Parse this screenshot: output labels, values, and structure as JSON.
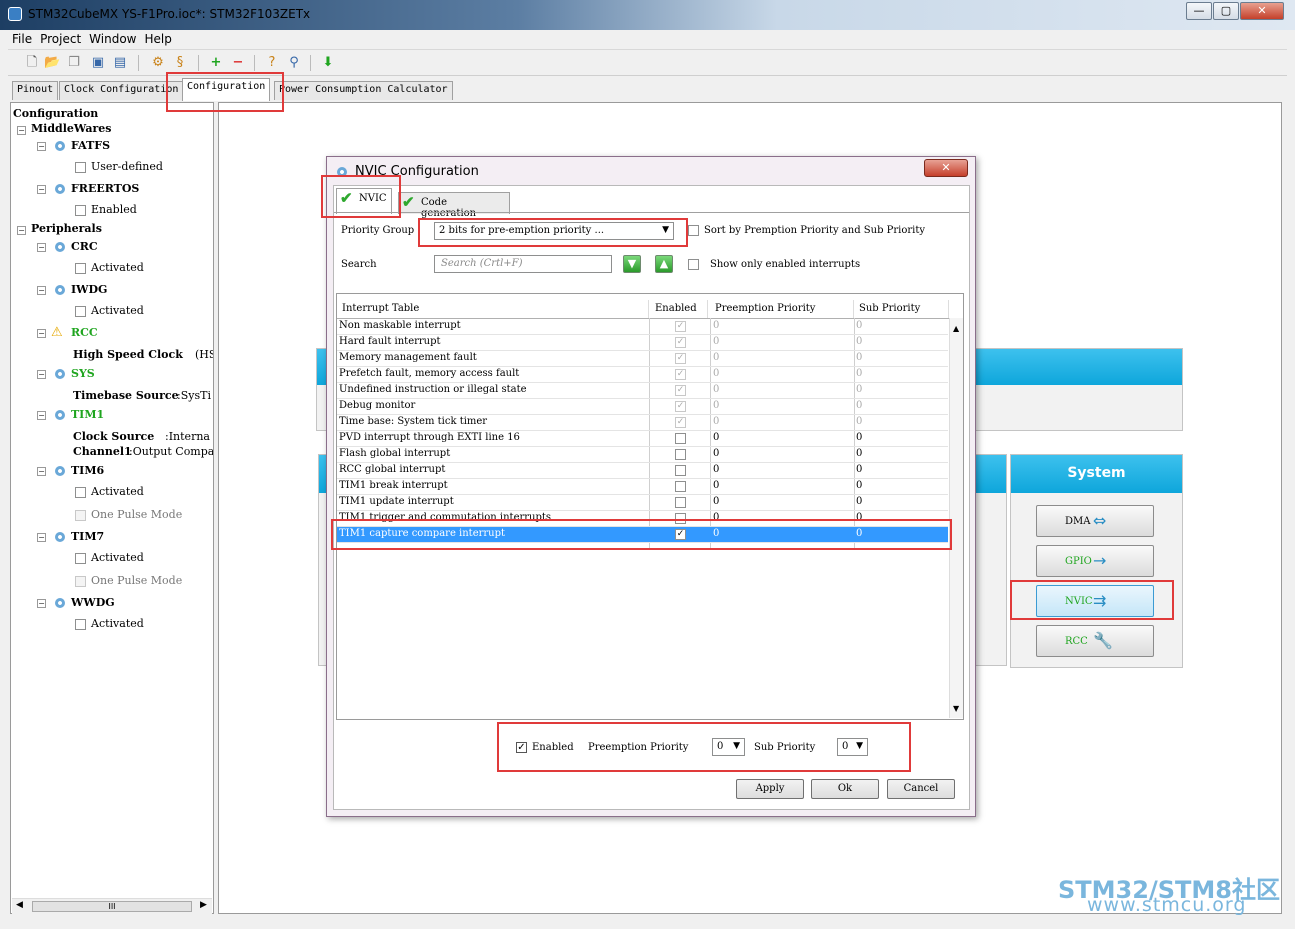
{
  "window": {
    "title": "STM32CubeMX YS-F1Pro.ioc*: STM32F103ZETx",
    "minimize": "—",
    "maximize": "▢",
    "close": "✕"
  },
  "menu": [
    "File",
    "Project",
    "Window",
    "Help"
  ],
  "main_tabs": [
    "Pinout",
    "Clock Configuration",
    "Configuration",
    "Power Consumption Calculator"
  ],
  "tree": {
    "root": "Configuration",
    "middlewares": "MiddleWares",
    "fatfs": "FATFS",
    "fatfs_opt": "User-defined",
    "freertos": "FREERTOS",
    "freertos_opt": "Enabled",
    "peripherals": "Peripherals",
    "crc": "CRC",
    "crc_opt": "Activated",
    "iwdg": "IWDG",
    "iwdg_opt": "Activated",
    "rcc": "RCC",
    "rcc_label": "High Speed Clock",
    "rcc_value": "(HS",
    "sys": "SYS",
    "sys_label": "Timebase Source",
    "sys_value": ":SysTi",
    "tim1": "TIM1",
    "tim1_label1": "Clock Source",
    "tim1_value1": ":Interna",
    "tim1_label2": "Channel1",
    "tim1_value2": ":Output Compar",
    "tim6": "TIM6",
    "tim6_opt1": "Activated",
    "tim6_opt2": "One Pulse Mode",
    "tim7": "TIM7",
    "tim7_opt1": "Activated",
    "tim7_opt2": "One Pulse Mode",
    "wwdg": "WWDG",
    "wwdg_opt": "Activated",
    "hscroll_thumb": "III"
  },
  "system_panel": {
    "title": "System",
    "buttons": [
      "DMA",
      "GPIO",
      "NVIC",
      "RCC"
    ]
  },
  "dialog": {
    "title": "NVIC Configuration",
    "close": "✕",
    "tabs": [
      "NVIC",
      "Code generation"
    ],
    "priority_group_label": "Priority Group",
    "priority_group_value": "2 bits for pre-emption priority ...",
    "sort_label": "Sort by Premption Priority and Sub Priority",
    "search_label": "Search",
    "search_placeholder": "Search (Crtl+F)",
    "show_enabled_label": "Show only enabled interrupts",
    "columns": [
      "Interrupt Table",
      "Enabled",
      "Preemption Priority",
      "Sub Priority"
    ],
    "rows": [
      {
        "name": "Non maskable interrupt",
        "pre": "0",
        "sub": "0"
      },
      {
        "name": "Hard fault interrupt",
        "pre": "0",
        "sub": "0"
      },
      {
        "name": "Memory management fault",
        "pre": "0",
        "sub": "0"
      },
      {
        "name": "Prefetch fault, memory access fault",
        "pre": "0",
        "sub": "0"
      },
      {
        "name": "Undefined instruction or illegal state",
        "pre": "0",
        "sub": "0"
      },
      {
        "name": "Debug monitor",
        "pre": "0",
        "sub": "0"
      },
      {
        "name": "Time base: System tick timer",
        "pre": "0",
        "sub": "0"
      },
      {
        "name": "PVD interrupt through EXTI line 16",
        "pre": "0",
        "sub": "0"
      },
      {
        "name": "Flash global interrupt",
        "pre": "0",
        "sub": "0"
      },
      {
        "name": "RCC global interrupt",
        "pre": "0",
        "sub": "0"
      },
      {
        "name": "TIM1 break interrupt",
        "pre": "0",
        "sub": "0"
      },
      {
        "name": "TIM1 update interrupt",
        "pre": "0",
        "sub": "0"
      },
      {
        "name": "TIM1 trigger and commutation interrupts",
        "pre": "0",
        "sub": "0"
      },
      {
        "name": "TIM1 capture compare interrupt",
        "pre": "0",
        "sub": "0"
      }
    ],
    "bottom_enabled_label": "Enabled",
    "bottom_preempt_label": "Preemption Priority",
    "bottom_preempt_value": "0",
    "bottom_sub_label": "Sub Priority",
    "bottom_sub_value": "0",
    "apply": "Apply",
    "ok": "Ok",
    "cancel": "Cancel"
  },
  "watermark": {
    "line1": "STM32/STM8社区",
    "line2": "www.stmcu.org"
  },
  "colors": {
    "accent_blue": "#0ea6db",
    "highlight_red": "#e03a3a",
    "selection": "#3399ff",
    "status_green": "#1fa51f"
  }
}
